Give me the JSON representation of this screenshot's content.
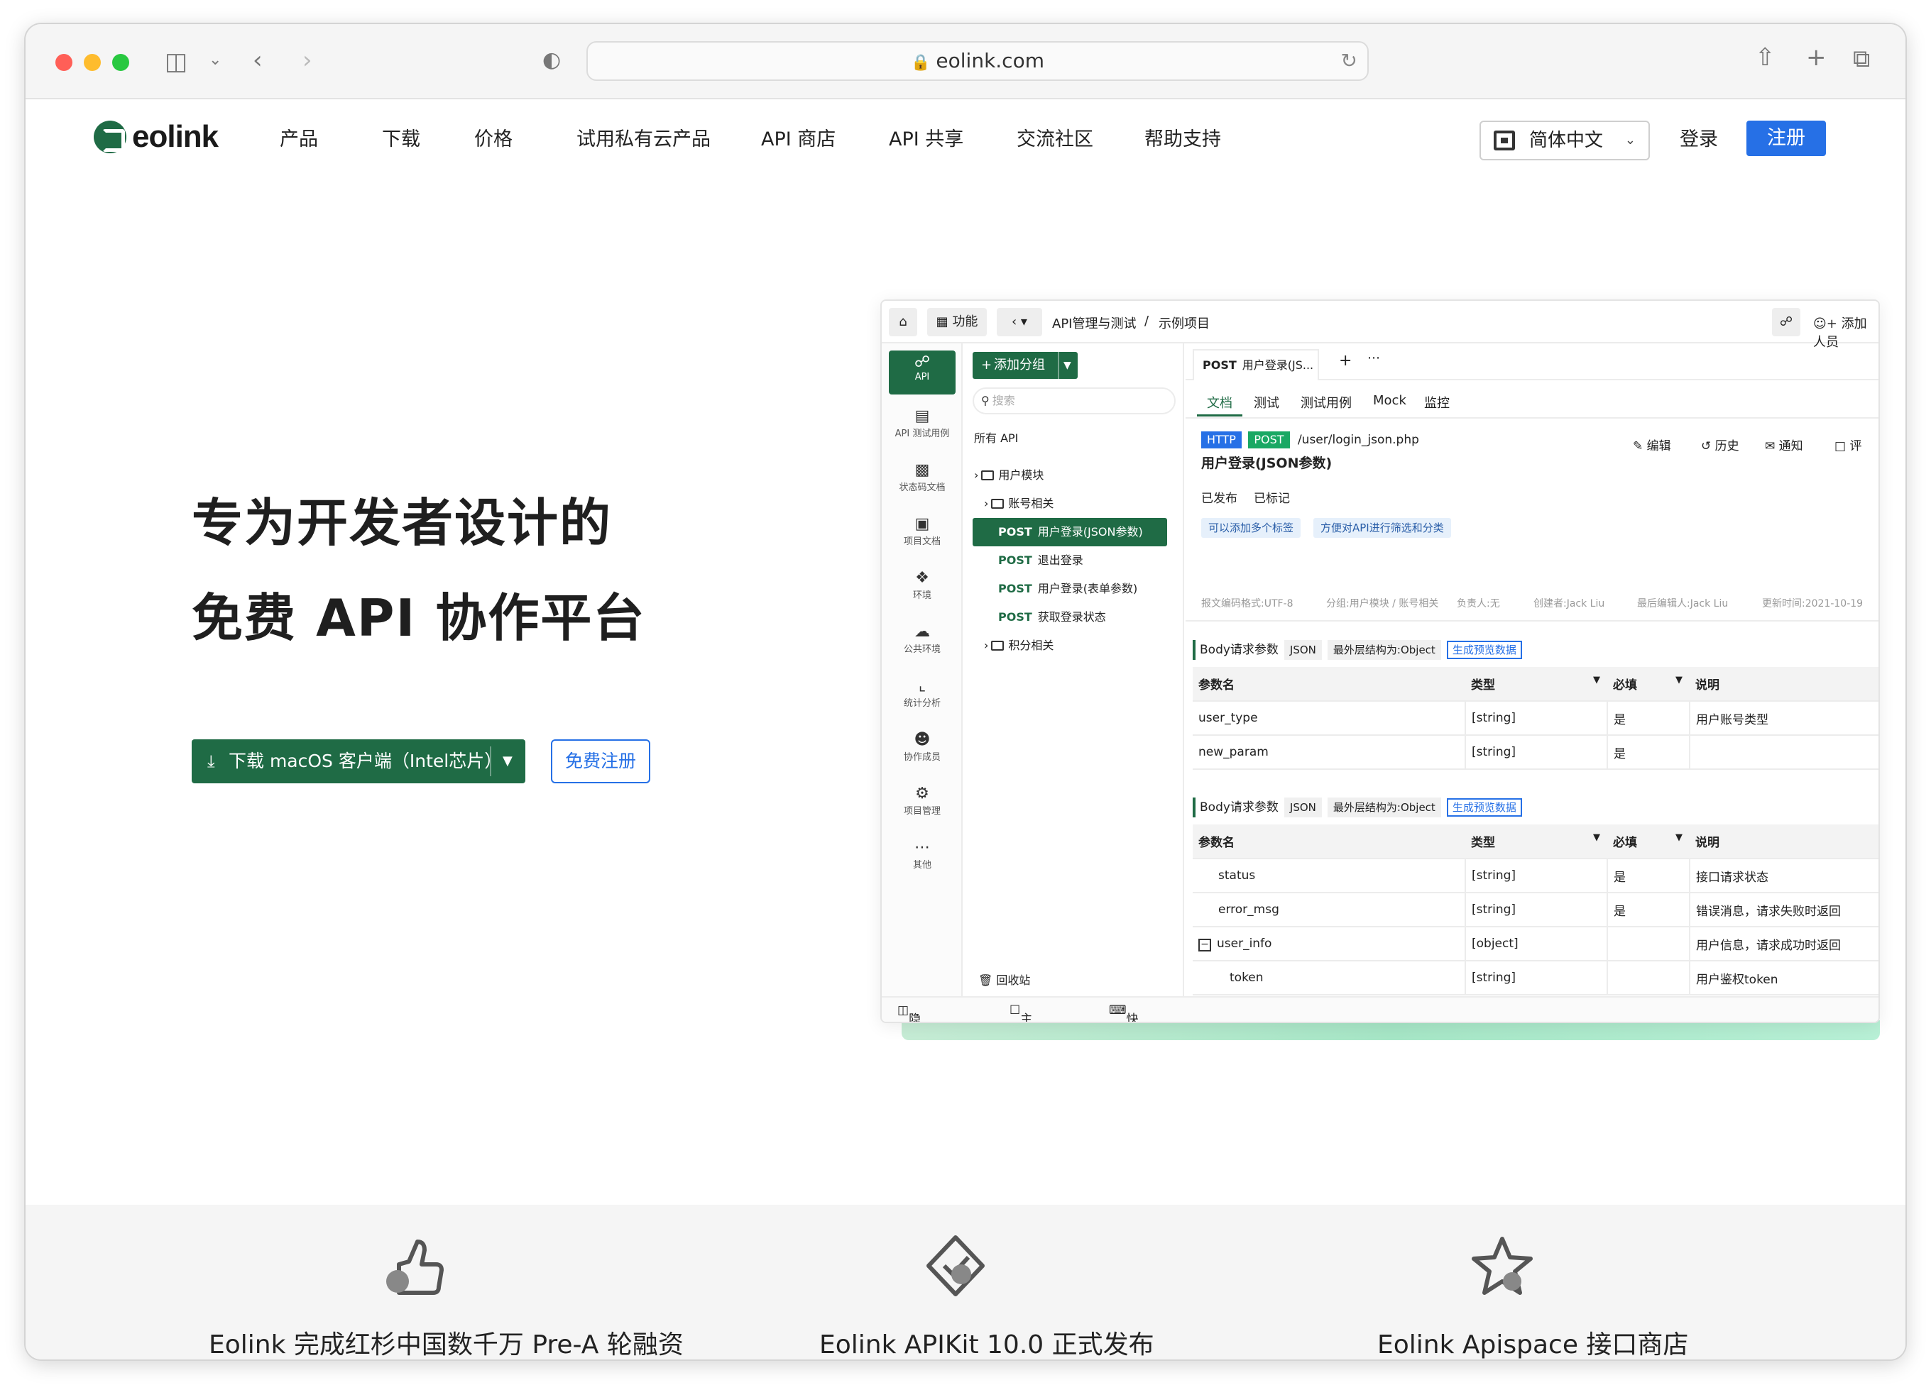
{
  "browser": {
    "url": "eolink.com"
  },
  "nav": {
    "brand": "eolink",
    "items": [
      "产品",
      "下载",
      "价格",
      "试用私有云产品",
      "API 商店",
      "API 共享",
      "交流社区",
      "帮助支持"
    ],
    "language": "简体中文",
    "login": "登录",
    "register": "注册"
  },
  "hero": {
    "line1": "专为开发者设计的",
    "line2": "免费 API 协作平台",
    "download_button": "下载 macOS 客户端（Intel芯片）",
    "signup_button": "免费注册"
  },
  "app": {
    "function_btn": "功能",
    "breadcrumb": [
      "API管理与测试",
      "/",
      "示例项目"
    ],
    "add_member": "添加人员",
    "sidebar": [
      "API",
      "API 测试用例",
      "状态码文档",
      "项目文档",
      "环境",
      "公共环境",
      "统计分析",
      "协作成员",
      "项目管理",
      "其他"
    ],
    "tree": {
      "add_group": "添加分组",
      "search_placeholder": "搜索",
      "all_api": "所有 API",
      "user_module": "用户模块",
      "account": "账号相关",
      "apis": [
        {
          "method": "POST",
          "name": "用户登录(JSON参数)"
        },
        {
          "method": "POST",
          "name": "退出登录"
        },
        {
          "method": "POST",
          "name": "用户登录(表单参数)"
        },
        {
          "method": "POST",
          "name": "获取登录状态"
        }
      ],
      "points": "积分相关",
      "recycle": "回收站"
    },
    "tab": {
      "method": "POST",
      "name": "用户登录(JS..."
    },
    "subtabs": [
      "文档",
      "测试",
      "测试用例",
      "Mock",
      "监控"
    ],
    "api": {
      "protocol": "HTTP",
      "method": "POST",
      "path": "/user/login_json.php",
      "title": "用户登录(JSON参数)",
      "status1": "已发布",
      "status2": "已标记",
      "tag1": "可以添加多个标签",
      "tag2": "方便对API进行筛选和分类",
      "actions": [
        "编辑",
        "历史",
        "通知",
        "评"
      ],
      "meta": [
        "报文编码格式:UTF-8",
        "分组:用户模块 / 账号相关",
        "负责人:无",
        "创建者:Jack Liu",
        "最后编辑人:Jack Liu",
        "更新时间:2021-10-19"
      ]
    },
    "section": {
      "label": "Body请求参数",
      "format": "JSON",
      "structure": "最外层结构为:Object",
      "gen": "生成预览数据"
    },
    "headers": [
      "参数名",
      "类型",
      "必填",
      "说明"
    ],
    "req_rows": [
      {
        "name": "user_type",
        "type": "[string]",
        "req": "是",
        "desc": "用户账号类型"
      },
      {
        "name": "new_param",
        "type": "[string]",
        "req": "是",
        "desc": ""
      }
    ],
    "resp_rows": [
      {
        "name": "status",
        "type": "[string]",
        "req": "是",
        "desc": "接口请求状态"
      },
      {
        "name": "error_msg",
        "type": "[string]",
        "req": "是",
        "desc": "错误消息，请求失败时返回"
      },
      {
        "name": "user_info",
        "type": "[object]",
        "req": "",
        "desc": "用户信息，请求成功时返回"
      },
      {
        "name": "token",
        "type": "[string]",
        "req": "",
        "desc": "用户鉴权token"
      }
    ],
    "bottom": [
      "隐藏侧边栏",
      "主题肤色",
      "快捷键"
    ]
  },
  "features": [
    {
      "icon": "thumbs-up-icon",
      "title": "Eolink 完成红杉中国数千万 Pre-A 轮融资"
    },
    {
      "icon": "diamond-badge-icon",
      "title": "Eolink APIKit 10.0 正式发布"
    },
    {
      "icon": "star-icon",
      "title": "Eolink Apispace 接口商店"
    }
  ],
  "colors": {
    "brand_green": "#1f6b45",
    "accent_blue": "#2670e6"
  }
}
